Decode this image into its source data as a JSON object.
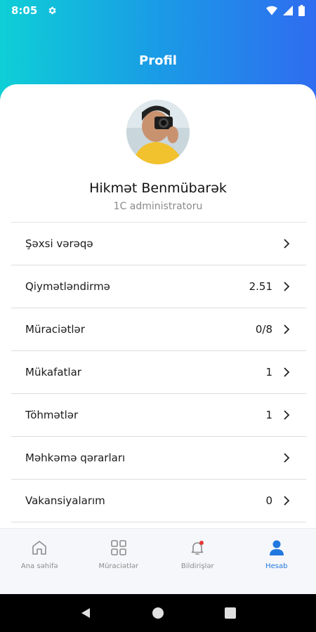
{
  "status_bar": {
    "time": "8:05",
    "icons": [
      "settings-gear-icon",
      "wifi-icon",
      "signal-icon",
      "battery-icon"
    ]
  },
  "header": {
    "title": "Profil"
  },
  "profile": {
    "name": "Hikmət Benmübarək",
    "role": "1C administratoru"
  },
  "menu": [
    {
      "label": "Şəxsi vərəqə",
      "value": ""
    },
    {
      "label": "Qiymətləndirmə",
      "value": "2.51"
    },
    {
      "label": "Müraciətlər",
      "value": "0/8"
    },
    {
      "label": "Mükafatlar",
      "value": "1"
    },
    {
      "label": "Töhmətlər",
      "value": "1"
    },
    {
      "label": "Məhkəmə qərarları",
      "value": ""
    },
    {
      "label": "Vakansiyalarım",
      "value": "0"
    }
  ],
  "bottom_nav": [
    {
      "label": "Ana səhifə",
      "icon": "home-icon",
      "active": false
    },
    {
      "label": "Müraciətlər",
      "icon": "grid-icon",
      "active": false
    },
    {
      "label": "Bildirişlər",
      "icon": "bell-icon",
      "active": false
    },
    {
      "label": "Hesab",
      "icon": "user-icon",
      "active": true
    }
  ],
  "colors": {
    "gradient_start": "#0ecfd6",
    "gradient_end": "#2f6cf0",
    "active_nav": "#2178e0",
    "notification_dot": "#e53935"
  }
}
